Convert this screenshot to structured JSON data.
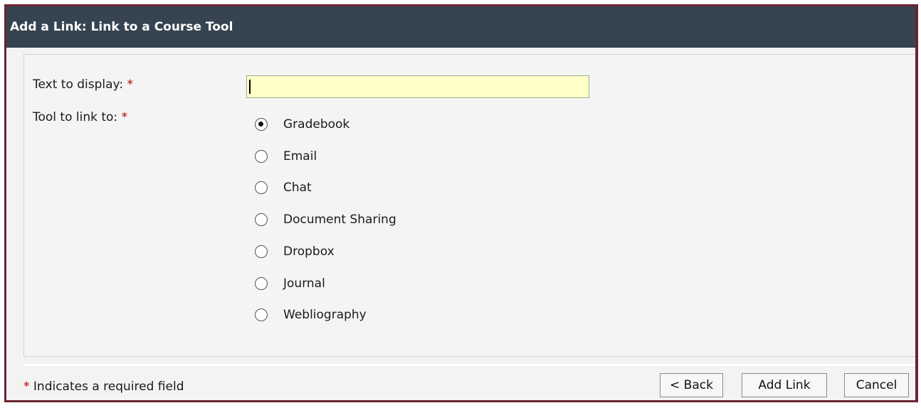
{
  "dialog": {
    "title": "Add a Link: Link to a Course Tool"
  },
  "form": {
    "text_label": "Text to display:",
    "text_value": "",
    "tool_label": "Tool to link to:",
    "required_marker": "*",
    "tools": [
      {
        "label": "Gradebook",
        "selected": true
      },
      {
        "label": "Email",
        "selected": false
      },
      {
        "label": "Chat",
        "selected": false
      },
      {
        "label": "Document Sharing",
        "selected": false
      },
      {
        "label": "Dropbox",
        "selected": false
      },
      {
        "label": "Journal",
        "selected": false
      },
      {
        "label": "Webliography",
        "selected": false
      }
    ]
  },
  "footer": {
    "required_note": "Indicates a required field",
    "back_label": "< Back",
    "add_label": "Add Link",
    "cancel_label": "Cancel"
  },
  "colors": {
    "title_bar": "#354450",
    "frame_border": "#6b2430",
    "input_background": "#ffffc8",
    "required": "#b00000"
  }
}
